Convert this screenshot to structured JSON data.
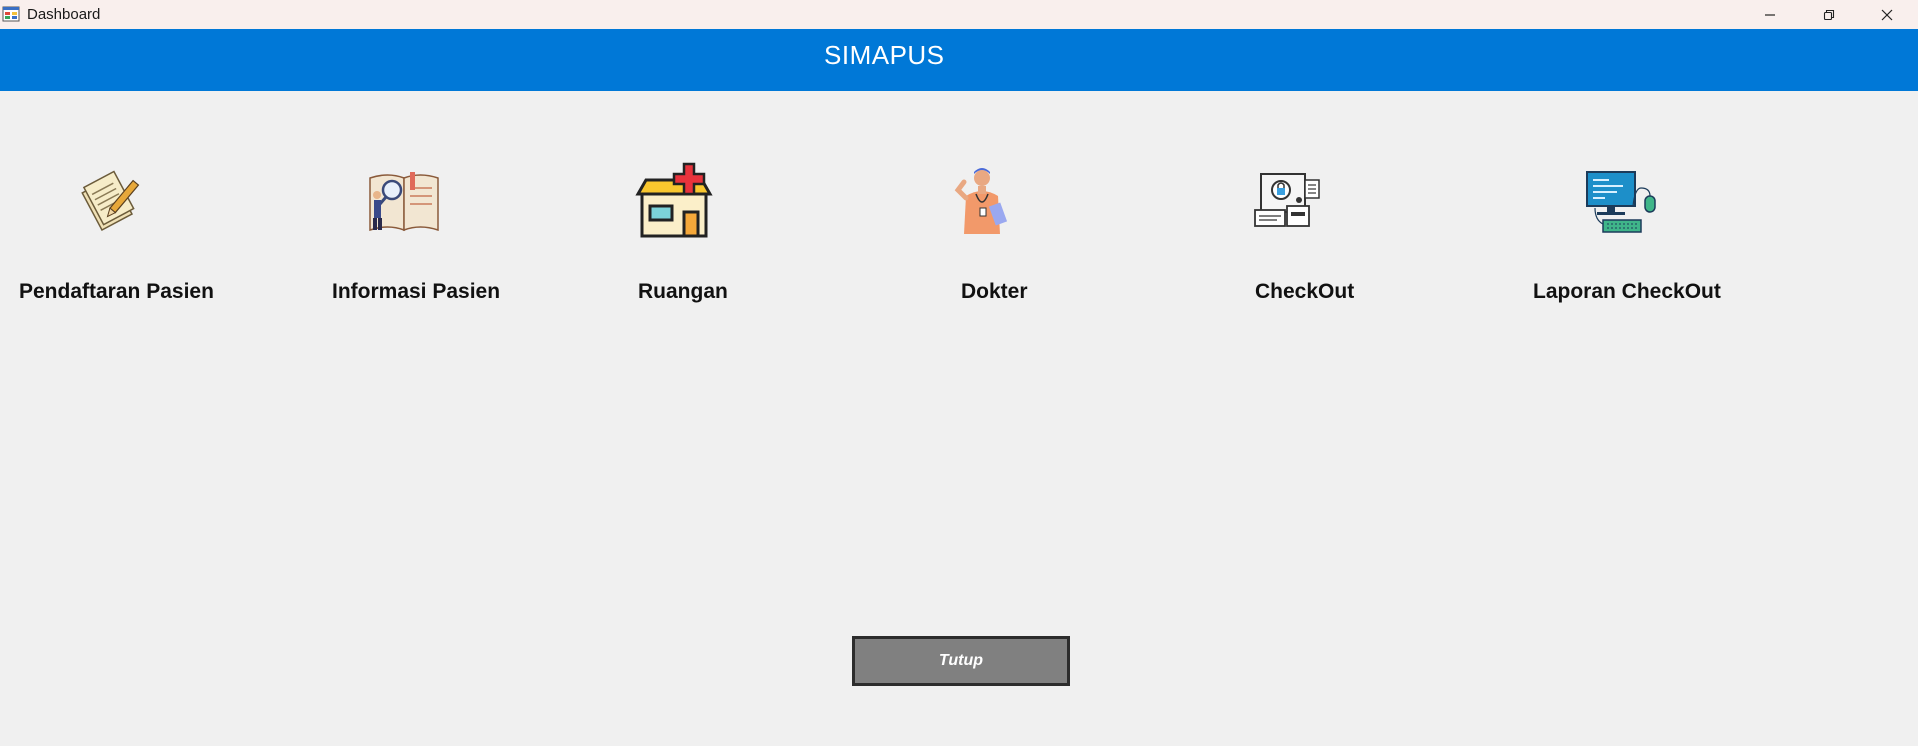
{
  "window": {
    "title": "Dashboard",
    "controls": {
      "minimize": "minimize-icon",
      "restore": "restore-icon",
      "close": "close-icon"
    }
  },
  "header": {
    "title": "SIMAPUS",
    "background": "#0078d7"
  },
  "menu": [
    {
      "label": "Pendaftaran Pasien",
      "icon": "registration-documents-icon"
    },
    {
      "label": "Informasi Pasien",
      "icon": "patient-info-book-icon"
    },
    {
      "label": "Ruangan",
      "icon": "room-building-icon"
    },
    {
      "label": "Dokter",
      "icon": "doctor-icon"
    },
    {
      "label": "CheckOut",
      "icon": "checkout-computer-icon"
    },
    {
      "label": "Laporan CheckOut",
      "icon": "checkout-report-computer-icon"
    }
  ],
  "footer": {
    "close_label": "Tutup"
  }
}
